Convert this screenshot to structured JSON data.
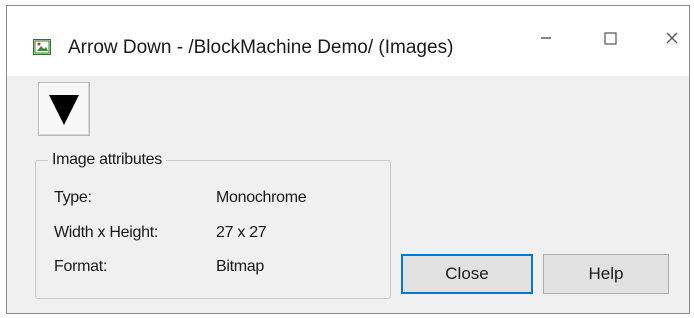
{
  "window": {
    "title": "Arrow Down - /BlockMachine Demo/ (Images)",
    "controls": [
      "minimize-icon",
      "maximize-icon",
      "close-icon"
    ]
  },
  "preview": {
    "icon": "arrow-down-icon",
    "color": "#000000"
  },
  "attributes": {
    "legend": "Image attributes",
    "rows": [
      {
        "label": "Type:",
        "value": "Monochrome"
      },
      {
        "label": "Width x Height:",
        "value": "27 x 27"
      },
      {
        "label": "Format:",
        "value": "Bitmap"
      }
    ]
  },
  "buttons": {
    "close_label": "Close",
    "help_label": "Help"
  }
}
